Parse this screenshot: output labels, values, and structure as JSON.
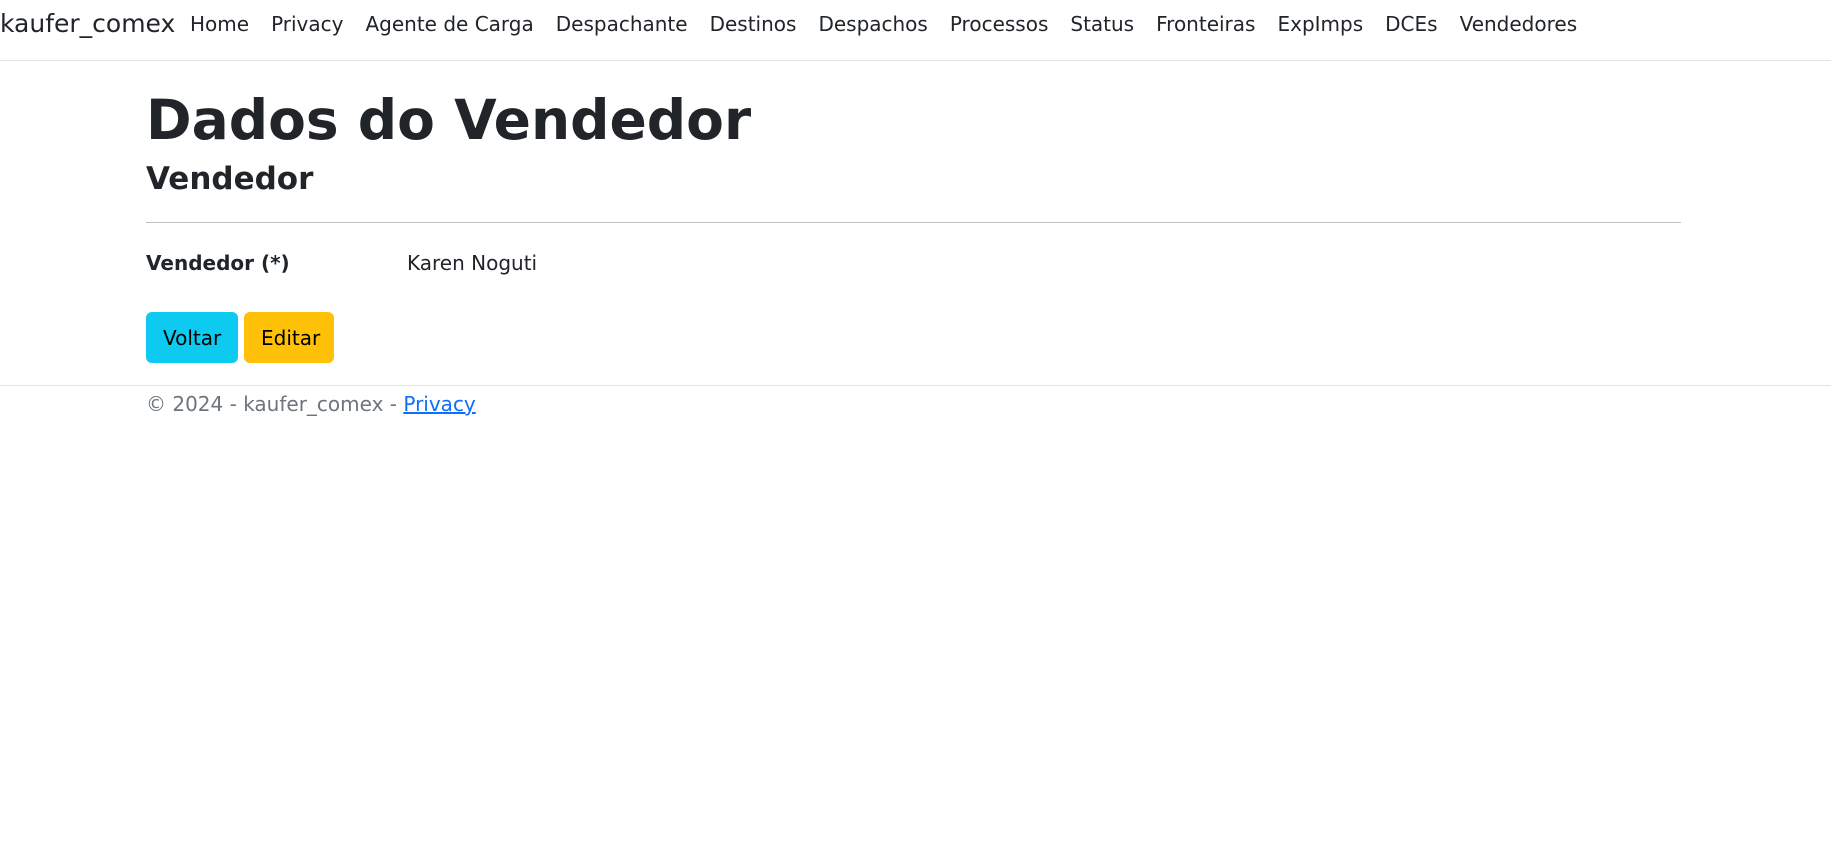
{
  "navbar": {
    "brand": "kaufer_comex",
    "items": [
      {
        "label": "Home"
      },
      {
        "label": "Privacy"
      },
      {
        "label": "Agente de Carga"
      },
      {
        "label": "Despachante"
      },
      {
        "label": "Destinos"
      },
      {
        "label": "Despachos"
      },
      {
        "label": "Processos"
      },
      {
        "label": "Status"
      },
      {
        "label": "Fronteiras"
      },
      {
        "label": "ExpImps"
      },
      {
        "label": "DCEs"
      },
      {
        "label": "Vendedores"
      }
    ]
  },
  "main": {
    "title": "Dados do Vendedor",
    "section_title": "Vendedor",
    "field": {
      "label": "Vendedor (*)",
      "value": "Karen Noguti"
    },
    "buttons": {
      "back_label": "Voltar",
      "edit_label": "Editar"
    }
  },
  "footer": {
    "copyright": "© 2024 - kaufer_comex - ",
    "privacy_link": "Privacy"
  },
  "colors": {
    "info_button": "#0dcaf0",
    "warning_button": "#ffc107",
    "link": "#0d6efd"
  }
}
